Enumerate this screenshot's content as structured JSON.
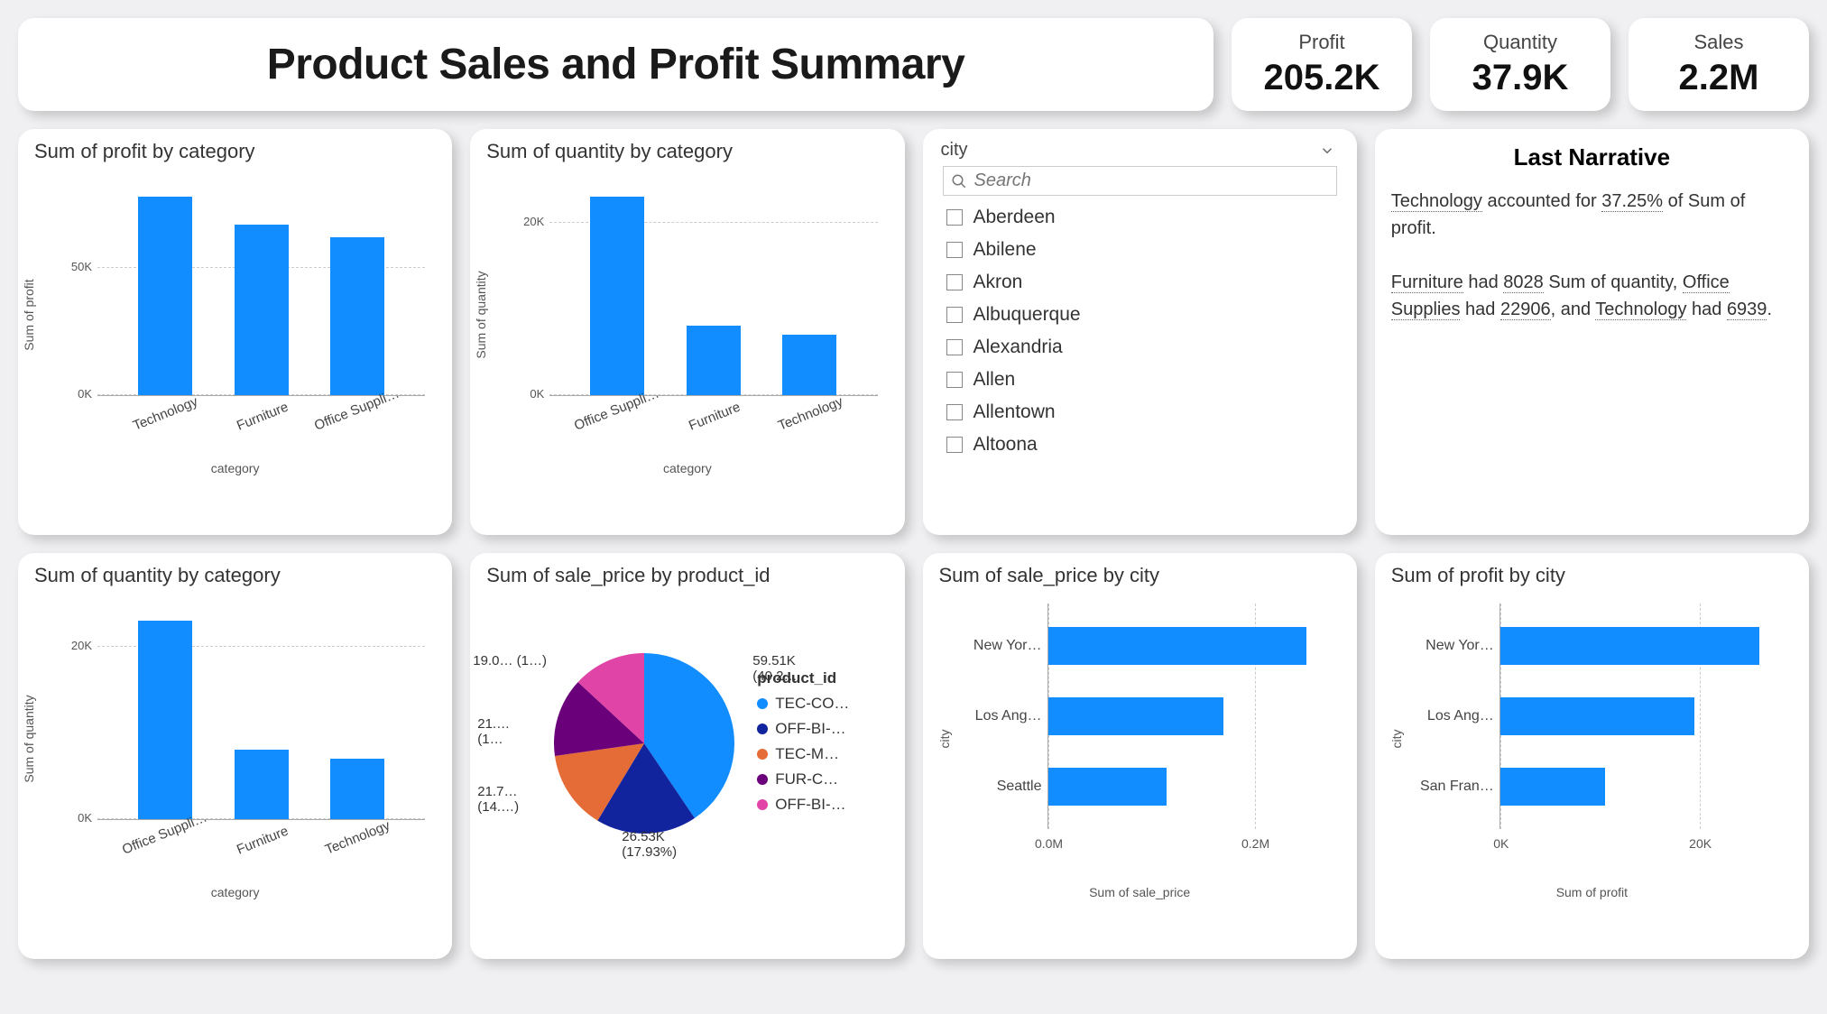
{
  "title": "Product Sales and Profit Summary",
  "kpis": [
    {
      "label": "Profit",
      "value": "205.2K"
    },
    {
      "label": "Quantity",
      "value": "37.9K"
    },
    {
      "label": "Sales",
      "value": "2.2M"
    }
  ],
  "slicer": {
    "field": "city",
    "search_placeholder": "Search",
    "items": [
      "Aberdeen",
      "Abilene",
      "Akron",
      "Albuquerque",
      "Alexandria",
      "Allen",
      "Allentown",
      "Altoona"
    ]
  },
  "narrative": {
    "title": "Last Narrative",
    "p1_parts": {
      "a": "Technology",
      "b": " accounted for ",
      "c": "37.25%",
      "d": " of Sum of profit."
    },
    "p2_parts": {
      "a": "Furniture",
      "b": " had ",
      "c": "8028",
      "d": " Sum of quantity, ",
      "e": "Office Supplies",
      "f": " had ",
      "g": "22906",
      "h": ", and ",
      "i": "Technology",
      "j": " had ",
      "k": "6939",
      "l": "."
    }
  },
  "axis_labels": {
    "category": "category",
    "sum_profit": "Sum of profit",
    "sum_quantity": "Sum of quantity",
    "sum_sale_price": "Sum of sale_price",
    "city": "city",
    "product_id": "product_id"
  },
  "chart_data": [
    {
      "id": "profit_by_category",
      "type": "bar",
      "title": "Sum of profit by category",
      "xlabel": "category",
      "ylabel": "Sum of profit",
      "categories": [
        "Technology",
        "Furniture",
        "Office Suppli…"
      ],
      "values": [
        78000,
        67000,
        62000
      ],
      "y_ticks": [
        0,
        50000
      ],
      "y_tick_labels": [
        "0K",
        "50K"
      ],
      "ylim": [
        0,
        85000
      ]
    },
    {
      "id": "quantity_by_category_top",
      "type": "bar",
      "title": "Sum of quantity by category",
      "xlabel": "category",
      "ylabel": "Sum of quantity",
      "categories": [
        "Office Suppli…",
        "Furniture",
        "Technology"
      ],
      "values": [
        22906,
        8028,
        6939
      ],
      "y_ticks": [
        0,
        20000
      ],
      "y_tick_labels": [
        "0K",
        "20K"
      ],
      "ylim": [
        0,
        25000
      ]
    },
    {
      "id": "quantity_by_category_bottom",
      "type": "bar",
      "title": "Sum of quantity by category",
      "xlabel": "category",
      "ylabel": "Sum of quantity",
      "categories": [
        "Office Suppli…",
        "Furniture",
        "Technology"
      ],
      "values": [
        22906,
        8028,
        6939
      ],
      "y_ticks": [
        0,
        20000
      ],
      "y_tick_labels": [
        "0K",
        "20K"
      ],
      "ylim": [
        0,
        25000
      ]
    },
    {
      "id": "sale_by_product",
      "type": "pie",
      "title": "Sum of sale_price by product_id",
      "legend_title": "product_id",
      "slices": [
        {
          "label": "TEC-CO…",
          "value": 59.51,
          "pct": 40.2,
          "color": "#118dff",
          "callout": "59.51K\n(40.2…"
        },
        {
          "label": "OFF-BI-…",
          "value": 26.53,
          "pct": 17.93,
          "color": "#12239e",
          "callout": "26.53K\n(17.93%)"
        },
        {
          "label": "TEC-M…",
          "value": 21.7,
          "pct": 14.0,
          "color": "#e66c37",
          "callout": "21.7…\n(14.…)"
        },
        {
          "label": "FUR-C…",
          "value": 21.0,
          "pct": 14.0,
          "color": "#6b007b",
          "callout": "21.…\n(1…"
        },
        {
          "label": "OFF-BI-…",
          "value": 19.0,
          "pct": 13.0,
          "color": "#e044a7",
          "callout": "19.0… (1…)"
        }
      ]
    },
    {
      "id": "sale_by_city",
      "type": "bar_h",
      "title": "Sum of sale_price by city",
      "xlabel": "Sum of sale_price",
      "ylabel": "city",
      "categories": [
        "New Yor…",
        "Los Ang…",
        "Seattle"
      ],
      "values": [
        250000,
        170000,
        115000
      ],
      "x_ticks": [
        0,
        200000
      ],
      "x_tick_labels": [
        "0.0M",
        "0.2M"
      ],
      "xlim": [
        0,
        270000
      ]
    },
    {
      "id": "profit_by_city",
      "type": "bar_h",
      "title": "Sum of profit by city",
      "xlabel": "Sum of profit",
      "ylabel": "city",
      "categories": [
        "New Yor…",
        "Los Ang…",
        "San Fran…"
      ],
      "values": [
        26000,
        19500,
        10500
      ],
      "x_ticks": [
        0,
        20000
      ],
      "x_tick_labels": [
        "0K",
        "20K"
      ],
      "xlim": [
        0,
        28000
      ]
    }
  ]
}
